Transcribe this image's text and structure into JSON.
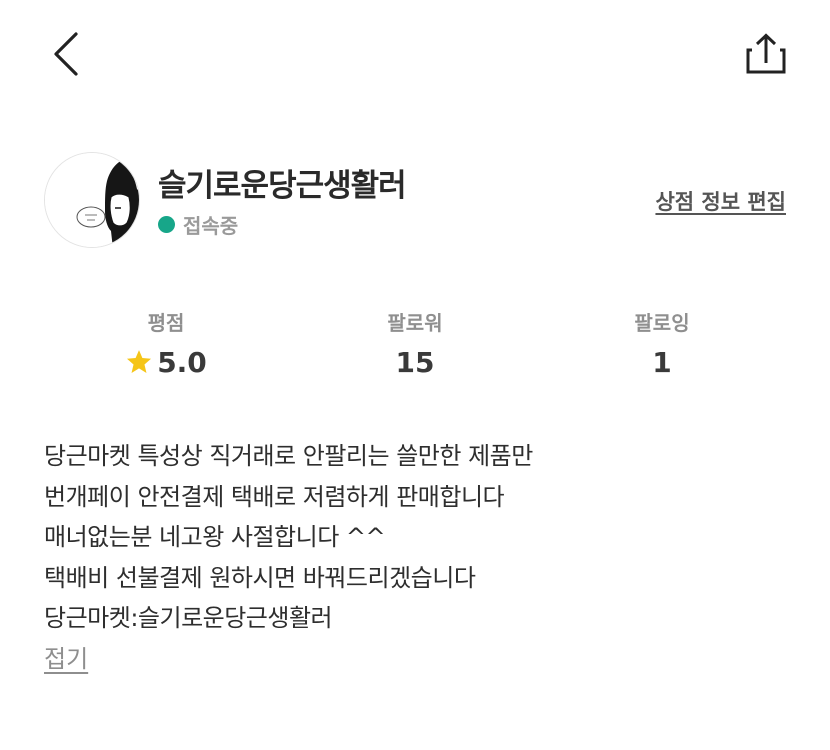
{
  "header": {
    "back_icon": "chevron-left-icon",
    "share_icon": "share-icon"
  },
  "profile": {
    "store_name": "슬기로운당근생활러",
    "status": "접속중",
    "status_color": "#17a689",
    "edit_label": "상점 정보 편집"
  },
  "stats": {
    "rating_label": "평점",
    "rating_value": "5.0",
    "rating_icon": "star-icon",
    "star_color": "#f5c518",
    "followers_label": "팔로워",
    "followers_value": "15",
    "following_label": "팔로잉",
    "following_value": "1"
  },
  "description": {
    "lines": [
      "당근마켓 특성상 직거래로 안팔리는 쓸만한 제품만",
      "번개페이 안전결제 택배로 저렴하게 판매합니다",
      "매너없는분 네고왕 사절합니다 ^^",
      "택배비 선불결제 원하시면 바꿔드리겠습니다",
      "당근마켓:슬기로운당근생활러"
    ],
    "collapse_label": "접기"
  }
}
